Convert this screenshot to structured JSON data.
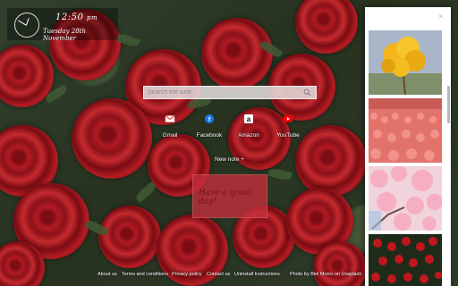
{
  "clock": {
    "time": "12:50",
    "suffix": "pm",
    "date": "Tuesday 28th November"
  },
  "search": {
    "placeholder": "Search the web"
  },
  "quick_links": [
    {
      "label": "Gmail",
      "icon": "gmail-icon",
      "color": "#ea4335"
    },
    {
      "label": "Facebook",
      "icon": "facebook-icon",
      "color": "#1877f2"
    },
    {
      "label": "Amazon",
      "icon": "amazon-icon",
      "color": "#111111"
    },
    {
      "label": "YouTube",
      "icon": "youtube-icon",
      "color": "#ff0000"
    }
  ],
  "notes": {
    "new_note_label": "New note +",
    "note_text": "Have a great day!"
  },
  "footer": {
    "links": [
      "About us",
      "Terms and conditions",
      "Privacy policy",
      "Contact us",
      "Uninstall Instructions"
    ],
    "photo_credit": "Photo by Biel Morro on Unsplash"
  },
  "panel": {
    "close_symbol": "×"
  },
  "colors": {
    "note_bg": "#c4303c",
    "search_bg": "#e6e1e1"
  }
}
